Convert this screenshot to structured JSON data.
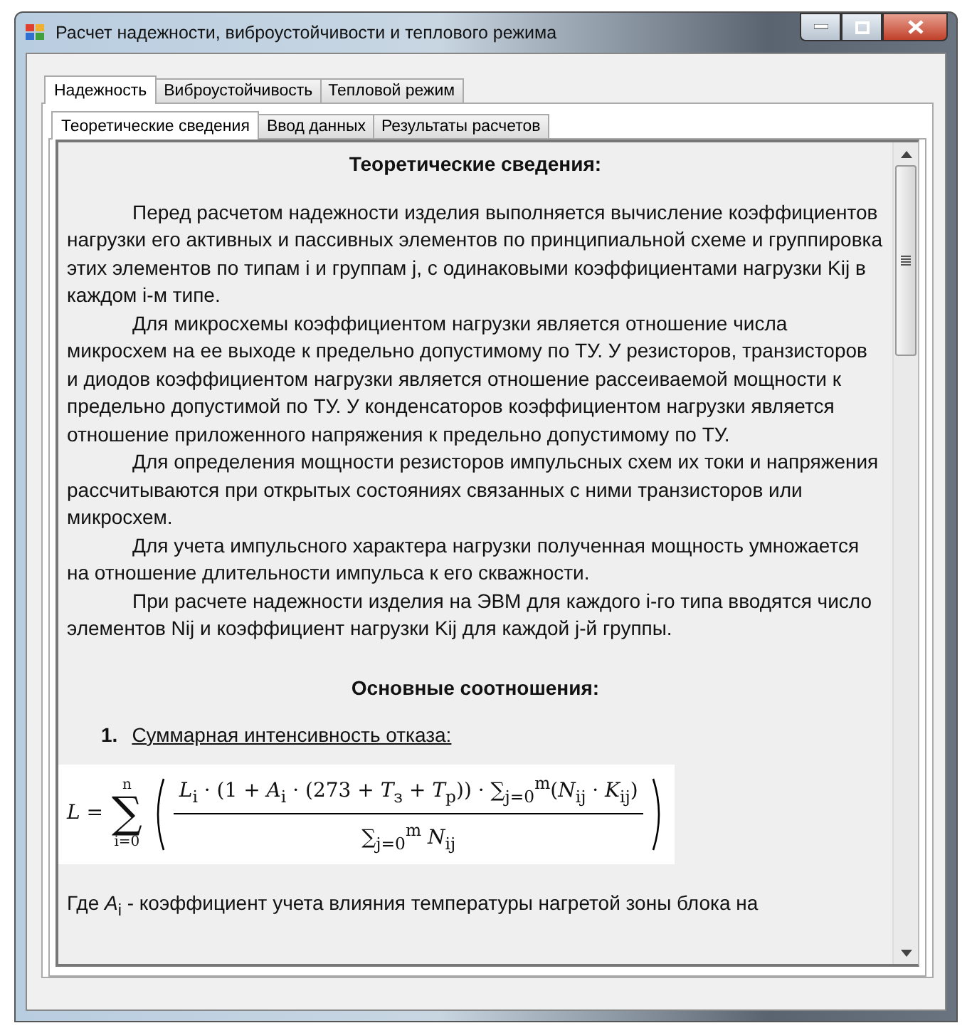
{
  "window": {
    "title": "Расчет надежности, виброустойчивости и теплового режима"
  },
  "tabs": [
    {
      "label": "Надежность",
      "selected": true
    },
    {
      "label": "Виброустойчивость",
      "selected": false
    },
    {
      "label": "Тепловой режим",
      "selected": false
    }
  ],
  "subtabs": [
    {
      "label": "Теоретические сведения",
      "selected": true
    },
    {
      "label": "Ввод данных",
      "selected": false
    },
    {
      "label": "Результаты расчетов",
      "selected": false
    }
  ],
  "document": {
    "heading": "Теоретические сведения:",
    "paragraphs": [
      "Перед расчетом надежности изделия выполняется вычисление коэффициентов нагрузки его активных и пассивных элементов по принципиальной схеме и группировка этих элементов по типам i и группам j, с одинаковыми коэффициентами нагрузки Kij в каждом i-м типе.",
      "Для микросхемы коэффициентом нагрузки является отношение числа микросхем на ее выходе к предельно допустимому по ТУ. У резисторов, транзисторов и диодов коэффициентом нагрузки является отношение рассеиваемой мощности к предельно допустимой по ТУ. У конденсаторов коэффициентом нагрузки является отношение приложенного напряжения к предельно допустимому по ТУ.",
      "Для определения мощности резисторов импульсных схем их токи и напряжения рассчитываются при открытых состояниях связанных с ними транзисторов или микросхем.",
      "Для учета импульсного характера нагрузки полученная мощность умножается на отношение длительности импульса к его скважности.",
      "При расчете надежности изделия на ЭВМ для каждого i-го типа вводятся число элементов Nij и коэффициент нагрузки Kij для каждой j-й группы."
    ],
    "subheading": "Основные соотношения:",
    "list_number": "1.",
    "list_item": "Суммарная интенсивность отказа:",
    "formula": {
      "lhs": "L =",
      "sum_upper": "n",
      "sum_sign": "∑",
      "sum_lower": "i=0",
      "numerator": "*L*$_{i}$ · (1 + *A*$_{i}$ · (273 + *T*$_{з}$ + *T*$_{p}$)) · ∑$_{j=0}$$^{m}$(*N*$_{ij}$ · *K*$_{ij}$)",
      "denominator": "∑$_{j=0}$$^{m}$ *N*$_{ij}$"
    },
    "note": "Где *A*$_{i}$ - коэффициент учета влияния температуры нагретой зоны блока на"
  }
}
